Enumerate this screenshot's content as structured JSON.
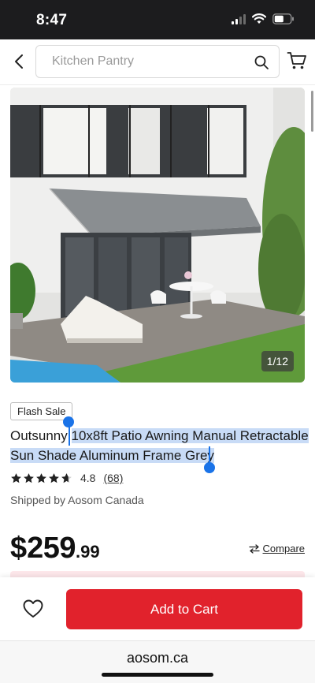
{
  "status_bar": {
    "time": "8:47"
  },
  "search": {
    "placeholder": "Kitchen Pantry"
  },
  "product": {
    "image_counter": "1/12",
    "badge": "Flash Sale",
    "brand": "Outsunny",
    "title_rest_line1": "10x8ft Patio Awning Manual Retractable",
    "title_rest_line2": "Sun Shade Aluminum Frame Grey",
    "rating_value": "4.8",
    "rating_stars": 4.8,
    "review_count": "(68)",
    "shipped_by": "Shipped by Aosom Canada",
    "price_currency": "$",
    "price_int": "259",
    "price_dec": ".99",
    "compare_label": "Compare"
  },
  "actions": {
    "add_to_cart": "Add to Cart"
  },
  "browser": {
    "url": "aosom.ca"
  },
  "colors": {
    "accent": "#e1222c",
    "highlight": "#c8dbf6",
    "selection": "#1a73e8"
  },
  "icons": [
    "back-chevron-icon",
    "search-icon",
    "cart-icon",
    "star-icon",
    "compare-arrows-icon",
    "heart-icon",
    "wifi-icon",
    "battery-icon",
    "signal-icon"
  ]
}
